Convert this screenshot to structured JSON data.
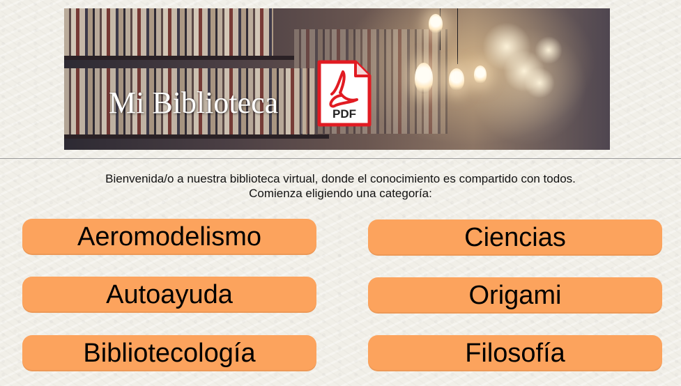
{
  "header": {
    "title": "Mi Biblioteca",
    "pdf_icon_label": "PDF",
    "pdf_icon": "pdf-file-icon",
    "pdf_icon_color": "#e11b22"
  },
  "intro": {
    "line1": "Bienvenida/o a nuestra biblioteca virtual, donde el conocimiento es compartido con todos.",
    "line2": "Comienza eligiendo una categoría:"
  },
  "categories": [
    {
      "label": "Aeromodelismo"
    },
    {
      "label": "Ciencias"
    },
    {
      "label": "Autoayuda"
    },
    {
      "label": "Origami"
    },
    {
      "label": "Bibliotecología"
    },
    {
      "label": "Filosofía"
    }
  ],
  "colors": {
    "button_bg": "#fca35d",
    "page_bg": "#f1efe8"
  }
}
